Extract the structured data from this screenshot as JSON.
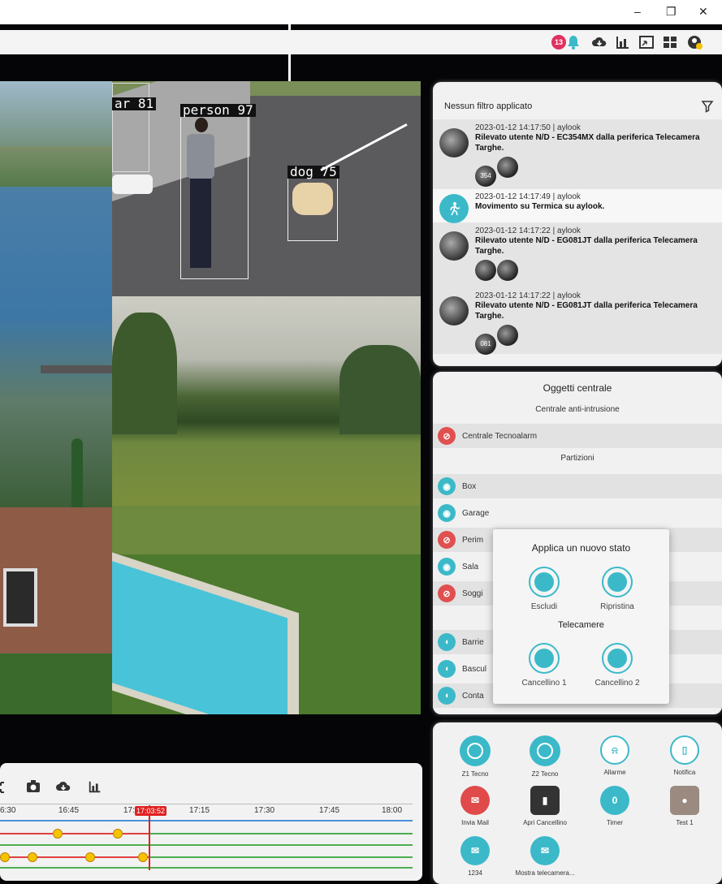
{
  "window": {
    "minimize": "–",
    "restore": "❐",
    "close": "✕"
  },
  "toolbar": {
    "badge": "13"
  },
  "detections": [
    {
      "label": "ar 81"
    },
    {
      "label": "person 97"
    },
    {
      "label": "dog 75"
    }
  ],
  "events": {
    "filter_label": "Nessun filtro applicato",
    "items": [
      {
        "ts": "2023-01-12 14:17:50 | aylook",
        "msg": "Rilevato utente N/D - EC354MX dalla periferica Telecamera Targhe.",
        "plate": "354"
      },
      {
        "ts": "2023-01-12 14:17:49 | aylook",
        "msg": "Movimento su Termica su aylook."
      },
      {
        "ts": "2023-01-12 14:17:22 | aylook",
        "msg": "Rilevato utente N/D - EG081JT dalla periferica Telecamera Targhe."
      },
      {
        "ts": "2023-01-12 14:17:22 | aylook",
        "msg": "Rilevato utente N/D - EG081JT dalla periferica Telecamera Targhe.",
        "plate": "081"
      }
    ]
  },
  "objects": {
    "title": "Oggetti centrale",
    "section1": "Centrale anti-intrusione",
    "central": "Centrale Tecnoalarm",
    "section2": "Partizioni",
    "partitions": [
      "Box",
      "Garage",
      "Perim",
      "Sala",
      "Soggi"
    ],
    "outputs": [
      "Barrie",
      "Bascul",
      "Conta"
    ]
  },
  "popup": {
    "title": "Applica un nuovo stato",
    "exclude": "Escludi",
    "restore": "Ripristina",
    "cameras_title": "Telecamere",
    "cam1": "Cancellino 1",
    "cam2": "Cancellino 2"
  },
  "actions": [
    {
      "label": "Z1 Tecno"
    },
    {
      "label": "Z2 Tecno"
    },
    {
      "label": "Allarme"
    },
    {
      "label": "Notifica"
    },
    {
      "label": "Invia Mail"
    },
    {
      "label": "Apri Cancellino"
    },
    {
      "label": "Timer",
      "value": "0"
    },
    {
      "label": "Test 1"
    },
    {
      "label": "1234"
    },
    {
      "label": "Mostra telecamera..."
    }
  ],
  "timeline": {
    "ticks": [
      "6:30",
      "16:45",
      "17:",
      "17:15",
      "17:30",
      "17:45",
      "18:00"
    ],
    "cursor": "17:03:52"
  },
  "colors": {
    "accent": "#3bb9c9",
    "alert": "#e05050",
    "cursor": "#e02020"
  }
}
